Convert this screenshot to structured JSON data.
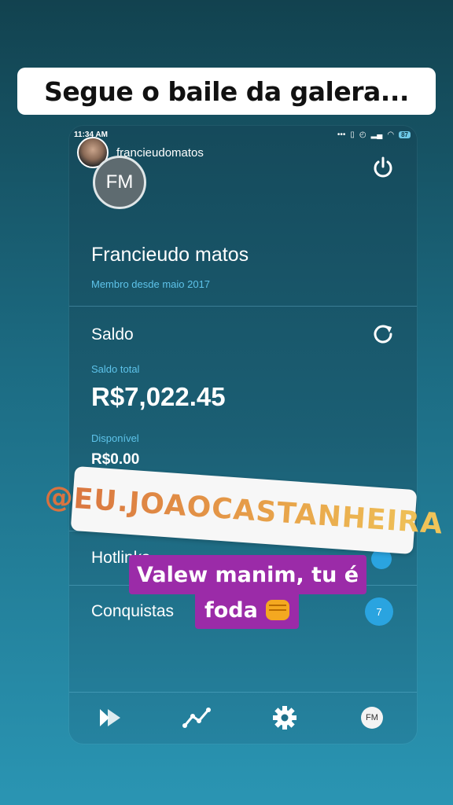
{
  "story": {
    "caption": "Segue o baile da galera...",
    "username": "francieudomatos"
  },
  "statusbar": {
    "time": "11:34 AM",
    "battery": "87",
    "indicators": "... ✈"
  },
  "profile": {
    "initials": "FM",
    "name": "Francieudo matos",
    "member_since": "Membro desde maio 2017"
  },
  "balance": {
    "title": "Saldo",
    "total_label": "Saldo total",
    "total_value": "R$7,022.45",
    "available_label": "Disponível",
    "available_value": "R$0.00"
  },
  "menu": {
    "hotlinks_label": "Hotlinks",
    "achievements_label": "Conquistas",
    "achievements_count": "7"
  },
  "stickers": {
    "mention": "@EU.JOAOCASTANHEIRA",
    "text_line1": "Valew manim, tu é",
    "text_line2": "foda"
  },
  "nav": {
    "avatar_initials": "FM"
  },
  "colors": {
    "accent": "#5ec3ea",
    "badge": "#2aa4e0",
    "sticker_purple": "#9b2ba8"
  }
}
